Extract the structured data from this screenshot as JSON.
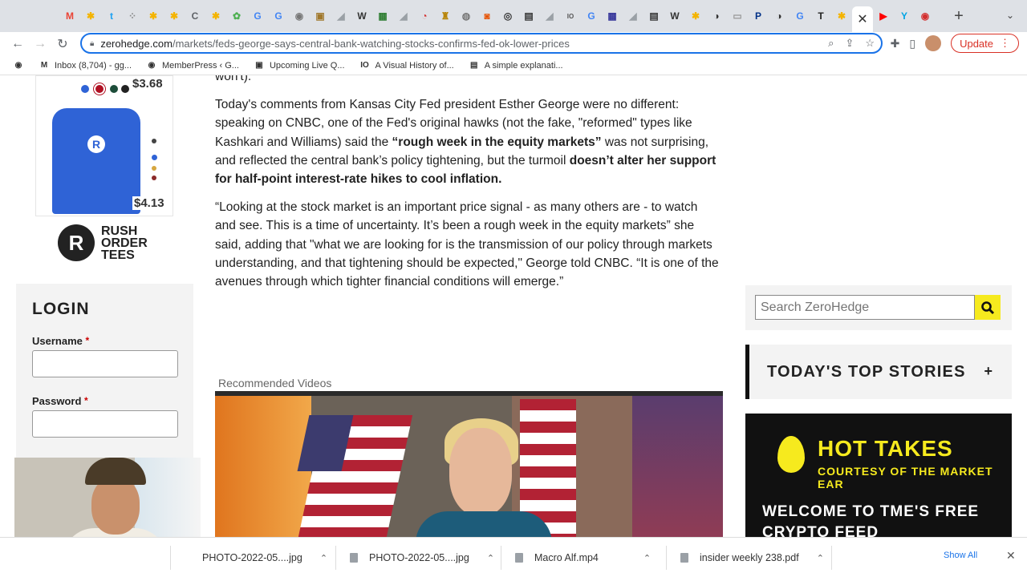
{
  "browser": {
    "active_tab_close": "✕",
    "new_tab": "+",
    "tab_menu": "⌄",
    "tab_favicons": [
      {
        "glyph": "M",
        "color": "#ea4335"
      },
      {
        "glyph": "✱",
        "color": "#f4b400"
      },
      {
        "glyph": "t",
        "color": "#1da1f2"
      },
      {
        "glyph": "⁘",
        "color": "#888888"
      },
      {
        "glyph": "✱",
        "color": "#f4b400"
      },
      {
        "glyph": "✱",
        "color": "#f4b400"
      },
      {
        "glyph": "C",
        "color": "#5f6368"
      },
      {
        "glyph": "✱",
        "color": "#f4b400"
      },
      {
        "glyph": "✿",
        "color": "#4caf50"
      },
      {
        "glyph": "G",
        "color": "#4285f4"
      },
      {
        "glyph": "G",
        "color": "#4285f4"
      },
      {
        "glyph": "◉",
        "color": "#777777"
      },
      {
        "glyph": "▣",
        "color": "#a0782c"
      },
      {
        "glyph": "◢",
        "color": "#9aa0a6"
      },
      {
        "glyph": "W",
        "color": "#333333"
      },
      {
        "glyph": "▦",
        "color": "#2e7d32"
      },
      {
        "glyph": "◢",
        "color": "#9aa0a6"
      },
      {
        "glyph": "◔",
        "color": "#d32f2f"
      },
      {
        "glyph": "♜",
        "color": "#b8860b"
      },
      {
        "glyph": "◍",
        "color": "#777777"
      },
      {
        "glyph": "◙",
        "color": "#e65100"
      },
      {
        "glyph": "◎",
        "color": "#333333"
      },
      {
        "glyph": "▤",
        "color": "#333333"
      },
      {
        "glyph": "◢",
        "color": "#9aa0a6"
      },
      {
        "glyph": "IO",
        "color": "#555555"
      },
      {
        "glyph": "G",
        "color": "#4285f4"
      },
      {
        "glyph": "▦",
        "color": "#333399"
      },
      {
        "glyph": "◢",
        "color": "#9aa0a6"
      },
      {
        "glyph": "▤",
        "color": "#333333"
      },
      {
        "glyph": "W",
        "color": "#333333"
      },
      {
        "glyph": "✱",
        "color": "#f4b400"
      },
      {
        "glyph": "◑",
        "color": "#333333"
      },
      {
        "glyph": "▭",
        "color": "#999999"
      },
      {
        "glyph": "P",
        "color": "#003087"
      },
      {
        "glyph": "◑",
        "color": "#333333"
      },
      {
        "glyph": "G",
        "color": "#4285f4"
      },
      {
        "glyph": "T",
        "color": "#222222"
      },
      {
        "glyph": "✱",
        "color": "#f4b400"
      }
    ],
    "tab_favicons_after": [
      {
        "glyph": "▶",
        "color": "#ff0000"
      },
      {
        "glyph": "Y",
        "color": "#00a4e4"
      },
      {
        "glyph": "◉",
        "color": "#d32f2f"
      }
    ],
    "url_host": "zerohedge.com",
    "url_path": "/markets/feds-george-says-central-bank-watching-stocks-confirms-fed-ok-lower-prices",
    "update_label": "Update",
    "bookmarks": [
      {
        "icon": "◉",
        "label": ""
      },
      {
        "icon": "M",
        "label": "Inbox (8,704) - gg..."
      },
      {
        "icon": "◉",
        "label": "MemberPress ‹ G..."
      },
      {
        "icon": "▣",
        "label": "Upcoming Live Q..."
      },
      {
        "icon": "IO",
        "label": "A Visual History of..."
      },
      {
        "icon": "▤",
        "label": "A simple explanati..."
      }
    ]
  },
  "sidebar_left": {
    "price_top": "$3.68",
    "price_bottom": "$4.13",
    "shirt_logo": "R",
    "brand_line1": "RUSH",
    "brand_line2": "ORDER",
    "brand_line3": "TEES",
    "login_title": "LOGIN",
    "username_label": "Username",
    "password_label": "Password",
    "required_mark": "*"
  },
  "article": {
    "p0": "won't).",
    "p1_a": "Today's comments from Kansas City Fed president Esther George were no different: speaking on CNBC, one of the Fed's original hawks (not the fake, \"reformed\" types like Kashkari and Williams) said the ",
    "p1_b": "“rough week in the equity markets”",
    "p1_c": " was not surprising, and reflected the central bank’s policy tightening, but the turmoil ",
    "p1_d": "doesn’t alter her support for half-point interest-rate hikes to cool inflation.",
    "p2": "“Looking at the stock market is an important price signal -  as many others are - to watch and see. This is a time of uncertainty. It’s been a rough week in the equity markets” she said, adding that \"what we are looking for is the transmission of our policy through markets understanding, and that tightening should be expected,\" George told CNBC. “It is one of the avenues through which tighter financial conditions will emerge.”",
    "recommended_label": "Recommended Videos"
  },
  "sidebar_right": {
    "search_placeholder": "Search ZeroHedge",
    "top_stories_title": "TODAY'S TOP STORIES",
    "top_stories_toggle": "+",
    "hot_takes_title": "HOT TAKES",
    "hot_takes_subtitle": "COURTESY OF THE MARKET EAR",
    "hot_takes_welcome_1": "WELCOME TO TME'S FREE",
    "hot_takes_welcome_2": "CRYPTO FEED"
  },
  "downloads": {
    "items": [
      "PHOTO-2022-05....jpg",
      "PHOTO-2022-05....jpg",
      "Macro Alf.mp4",
      "insider weekly 238.pdf"
    ],
    "chevron": "⌃",
    "show_all": "Show All",
    "close": "✕"
  }
}
